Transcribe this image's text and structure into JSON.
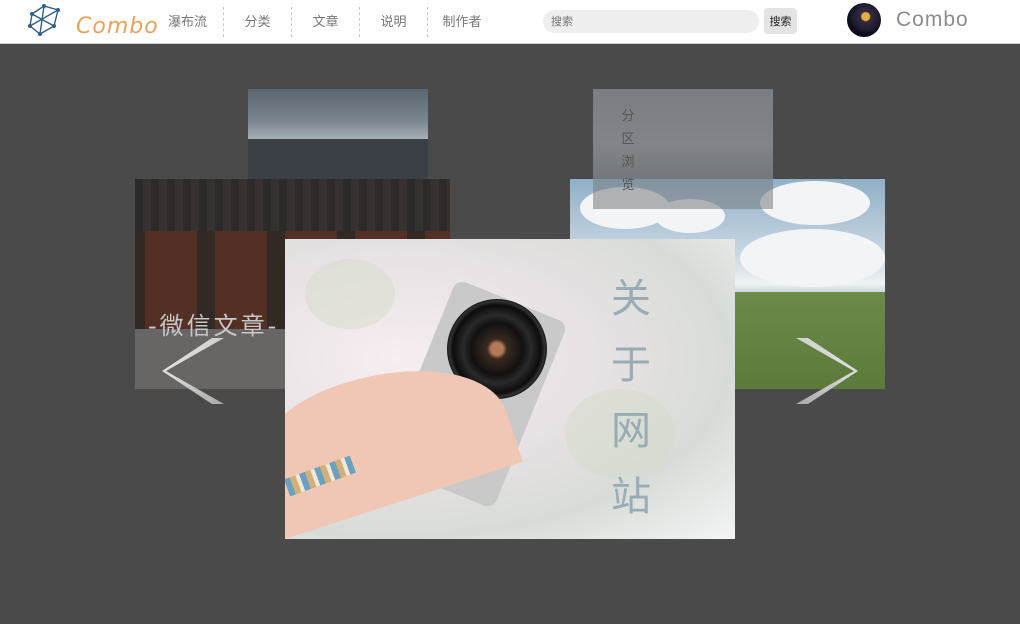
{
  "header": {
    "logo_text": "Combo",
    "nav": [
      {
        "label": "瀑布流",
        "name": "nav-waterfall",
        "width": 72
      },
      {
        "label": "分类",
        "name": "nav-category",
        "width": 68
      },
      {
        "label": "文章",
        "name": "nav-articles",
        "width": 68
      },
      {
        "label": "说明",
        "name": "nav-instructions",
        "width": 68
      },
      {
        "label": "制作者",
        "name": "nav-author",
        "width": 68
      }
    ],
    "search": {
      "placeholder": "搜索",
      "button_label": "搜索"
    },
    "username": "Combo"
  },
  "carousel": {
    "cards": [
      {
        "id": "back-left",
        "label": ""
      },
      {
        "id": "back-right",
        "label": "分区浏览"
      },
      {
        "id": "mid-left",
        "label": "-微信文章-"
      },
      {
        "id": "mid-right",
        "label": ""
      },
      {
        "id": "front",
        "label": "关于网站"
      }
    ],
    "prev_icon": "chevron-left-icon",
    "next_icon": "chevron-right-icon"
  },
  "colors": {
    "background": "#4a4a4a",
    "logo_accent": "#e8a25c",
    "front_title": "#98acb6"
  }
}
